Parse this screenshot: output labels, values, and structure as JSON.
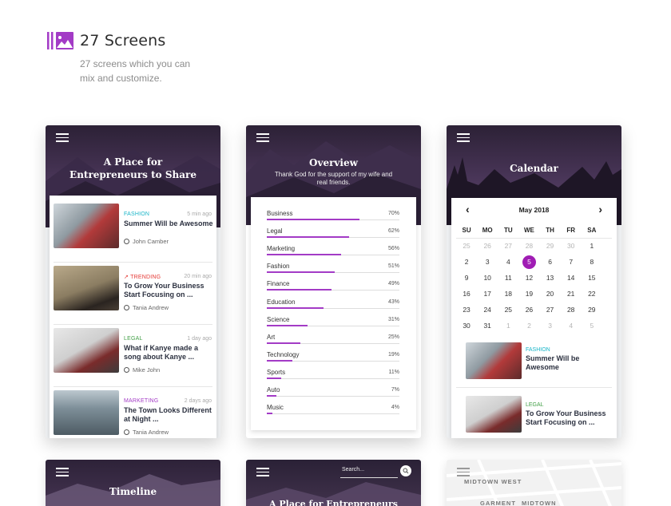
{
  "header": {
    "title": "27 Screens",
    "subtitle": "27 screens which you can mix and customize.",
    "logo_icon": "screens-gallery-icon",
    "accent": "#a33bc6"
  },
  "feed": {
    "hero_title": "A Place for Entrepreneurs to Share",
    "items": [
      {
        "category": "FASHION",
        "category_color": "#19b5c8",
        "time": "5 min ago",
        "title": "Summer Will be Awesome",
        "author": "John Camber"
      },
      {
        "category": "TRENDING",
        "category_color": "#e53935",
        "time": "20 min ago",
        "title": "To Grow Your Business Start Focusing on ...",
        "author": "Tania Andrew"
      },
      {
        "category": "LEGAL",
        "category_color": "#43a047",
        "time": "1 day ago",
        "title": "What if Kanye made a song about Kanye ...",
        "author": "Mike John"
      },
      {
        "category": "MARKETING",
        "category_color": "#a33bc6",
        "time": "2 days ago",
        "title": "The Town Looks Different at Night ...",
        "author": "Tania Andrew"
      }
    ]
  },
  "overview": {
    "hero_title": "Overview",
    "hero_subtitle": "Thank God for the support of my wife and real friends.",
    "rows": [
      {
        "label": "Business",
        "value": "70%",
        "pct": 70
      },
      {
        "label": "Legal",
        "value": "62%",
        "pct": 62
      },
      {
        "label": "Marketing",
        "value": "56%",
        "pct": 56
      },
      {
        "label": "Fashion",
        "value": "51%",
        "pct": 51
      },
      {
        "label": "Finance",
        "value": "49%",
        "pct": 49
      },
      {
        "label": "Education",
        "value": "43%",
        "pct": 43
      },
      {
        "label": "Science",
        "value": "31%",
        "pct": 31
      },
      {
        "label": "Art",
        "value": "25%",
        "pct": 25
      },
      {
        "label": "Technology",
        "value": "19%",
        "pct": 19
      },
      {
        "label": "Sports",
        "value": "11%",
        "pct": 11
      },
      {
        "label": "Auto",
        "value": "7%",
        "pct": 7
      },
      {
        "label": "Music",
        "value": "4%",
        "pct": 4
      }
    ]
  },
  "calendar": {
    "hero_title": "Calendar",
    "month_label": "May 2018",
    "weekdays": [
      "SU",
      "MO",
      "TU",
      "WE",
      "TH",
      "FR",
      "SA"
    ],
    "weeks": [
      [
        {
          "d": "25",
          "dim": true
        },
        {
          "d": "26",
          "dim": true
        },
        {
          "d": "27",
          "dim": true
        },
        {
          "d": "28",
          "dim": true
        },
        {
          "d": "29",
          "dim": true
        },
        {
          "d": "30",
          "dim": true
        },
        {
          "d": "1"
        }
      ],
      [
        {
          "d": "2"
        },
        {
          "d": "3"
        },
        {
          "d": "4"
        },
        {
          "d": "5",
          "sel": true
        },
        {
          "d": "6"
        },
        {
          "d": "7"
        },
        {
          "d": "8"
        }
      ],
      [
        {
          "d": "9"
        },
        {
          "d": "10"
        },
        {
          "d": "11"
        },
        {
          "d": "12"
        },
        {
          "d": "13"
        },
        {
          "d": "14"
        },
        {
          "d": "15"
        }
      ],
      [
        {
          "d": "16"
        },
        {
          "d": "17"
        },
        {
          "d": "18"
        },
        {
          "d": "19"
        },
        {
          "d": "20"
        },
        {
          "d": "21"
        },
        {
          "d": "22"
        }
      ],
      [
        {
          "d": "23"
        },
        {
          "d": "24"
        },
        {
          "d": "25"
        },
        {
          "d": "26"
        },
        {
          "d": "27"
        },
        {
          "d": "28"
        },
        {
          "d": "29"
        }
      ],
      [
        {
          "d": "30"
        },
        {
          "d": "31"
        },
        {
          "d": "1",
          "dim": true
        },
        {
          "d": "2",
          "dim": true
        },
        {
          "d": "3",
          "dim": true
        },
        {
          "d": "4",
          "dim": true
        },
        {
          "d": "5",
          "dim": true
        }
      ]
    ],
    "items": [
      {
        "category": "FASHION",
        "category_color": "#19b5c8",
        "title": "Summer Will be Awesome"
      },
      {
        "category": "LEGAL",
        "category_color": "#43a047",
        "title": "To Grow Your Business Start Focusing on ..."
      }
    ]
  },
  "bottom": {
    "timeline_title": "Timeline",
    "feed2_title": "A Place for Entrepreneurs",
    "search_placeholder": "Search...",
    "map_labels": [
      "MIDTOWN WEST",
      "GARMENT",
      "MIDTOWN"
    ]
  }
}
